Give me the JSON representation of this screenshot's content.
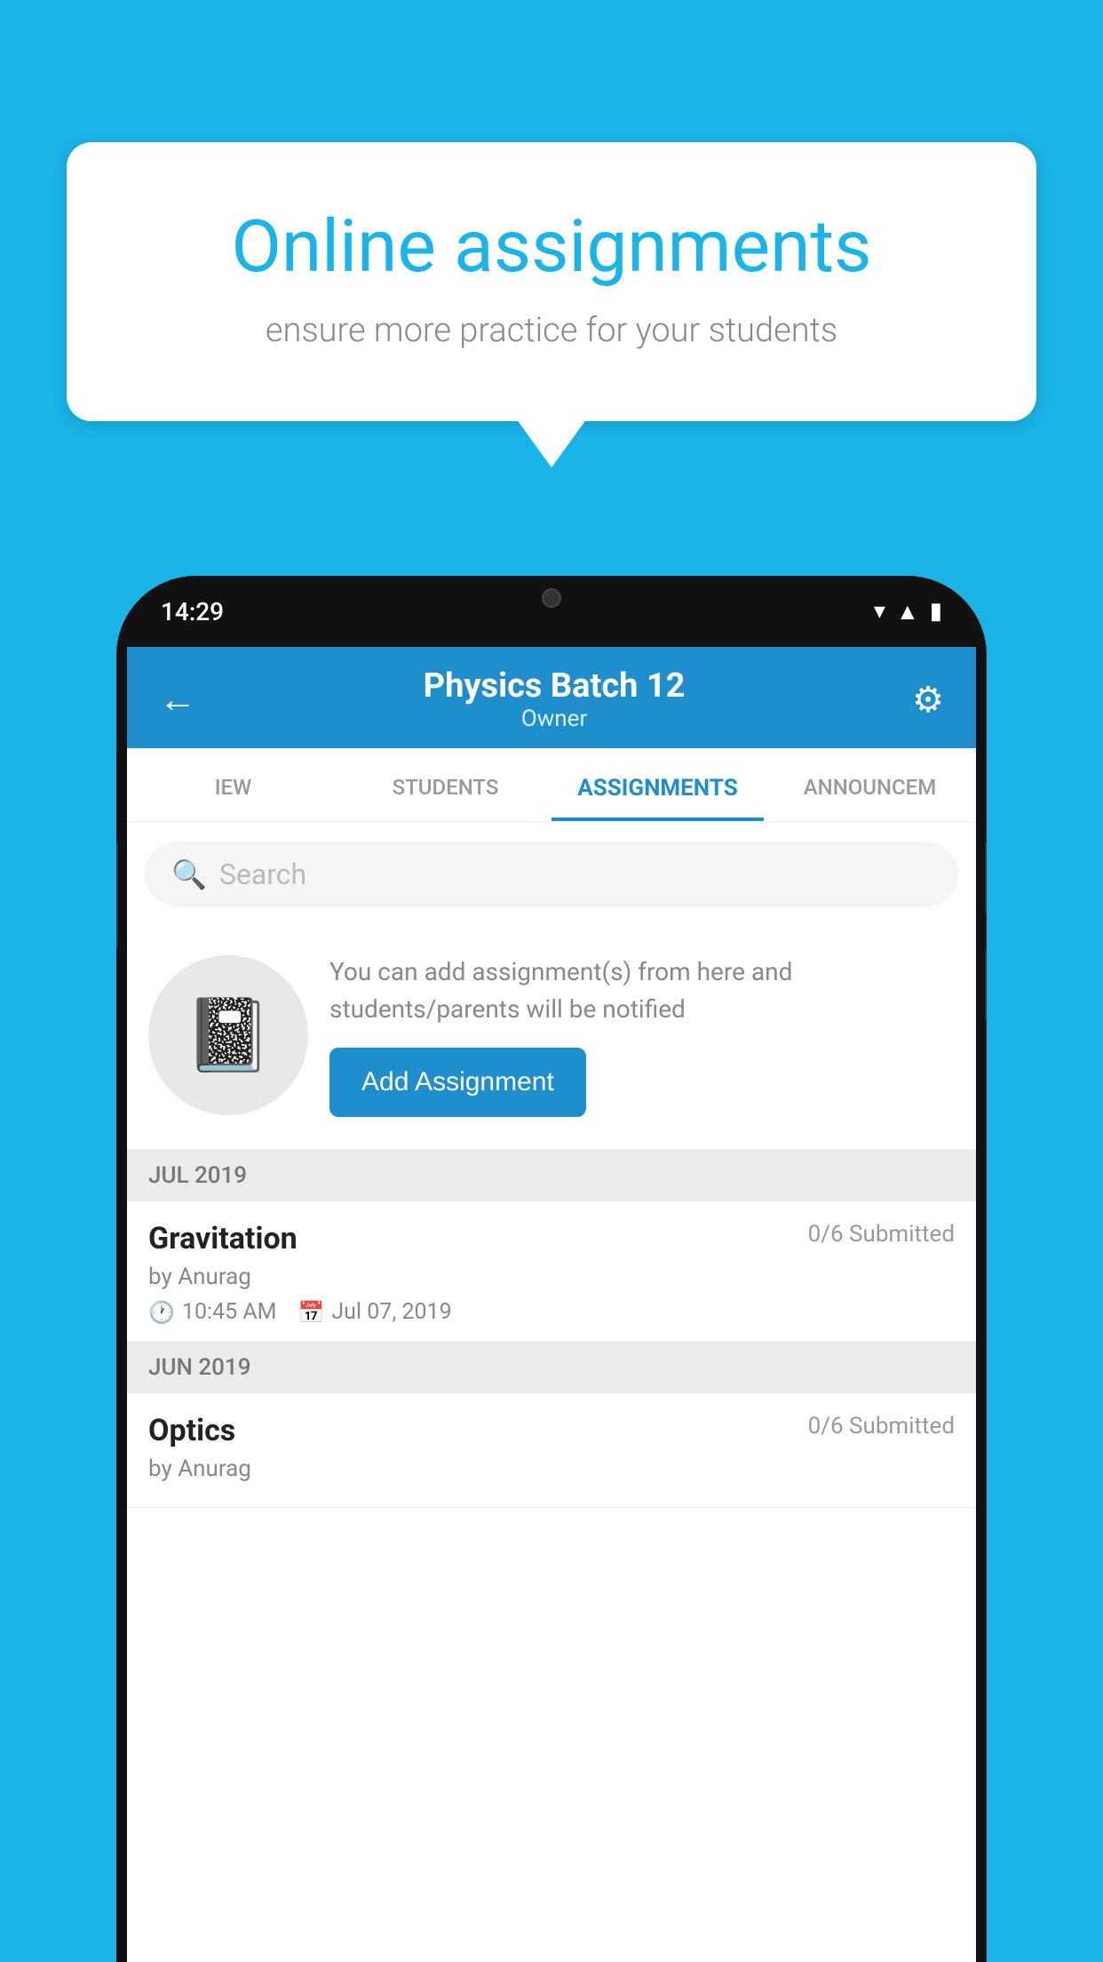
{
  "background_color": "#1ab4e8",
  "speech_bubble": {
    "title": "Online assignments",
    "subtitle": "ensure more practice for your students"
  },
  "phone": {
    "status_bar": {
      "time": "14:29",
      "icons": [
        "wifi",
        "signal",
        "battery"
      ]
    },
    "header": {
      "title": "Physics Batch 12",
      "subtitle": "Owner",
      "back_label": "←",
      "settings_label": "⚙"
    },
    "tabs": [
      {
        "label": "IEW",
        "active": false
      },
      {
        "label": "STUDENTS",
        "active": false
      },
      {
        "label": "ASSIGNMENTS",
        "active": true
      },
      {
        "label": "ANNOUNCEM",
        "active": false
      }
    ],
    "search": {
      "placeholder": "Search"
    },
    "empty_state": {
      "description": "You can add assignment(s) from here and students/parents will be notified",
      "button_label": "Add Assignment"
    },
    "sections": [
      {
        "month_label": "JUL 2019",
        "assignments": [
          {
            "name": "Gravitation",
            "submitted": "0/6 Submitted",
            "author": "by Anurag",
            "time": "10:45 AM",
            "date": "Jul 07, 2019"
          }
        ]
      },
      {
        "month_label": "JUN 2019",
        "assignments": [
          {
            "name": "Optics",
            "submitted": "0/6 Submitted",
            "author": "by Anurag",
            "time": "",
            "date": ""
          }
        ]
      }
    ]
  }
}
